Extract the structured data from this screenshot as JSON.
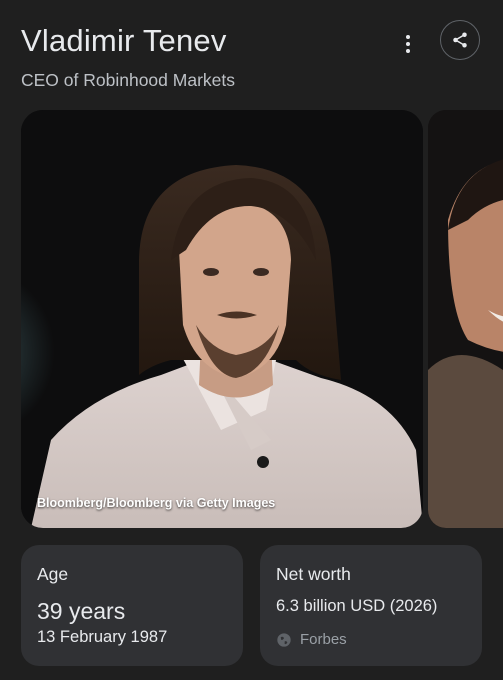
{
  "header": {
    "name": "Vladimir Tenev",
    "role": "CEO of Robinhood Markets"
  },
  "icons": {
    "more": "more-vert-icon",
    "share": "share-icon",
    "source": "globe-icon"
  },
  "images": {
    "main_caption": "Bloomberg/Bloomberg via Getty Images"
  },
  "cards": {
    "age": {
      "label": "Age",
      "value": "39 years",
      "date": "13 February 1987"
    },
    "net_worth": {
      "label": "Net worth",
      "value": "6.3 billion USD (2026)",
      "source": "Forbes"
    }
  },
  "colors": {
    "background": "#1f1f1f",
    "card": "#303134",
    "text": "#e8eaed",
    "muted": "#9aa0a6"
  }
}
